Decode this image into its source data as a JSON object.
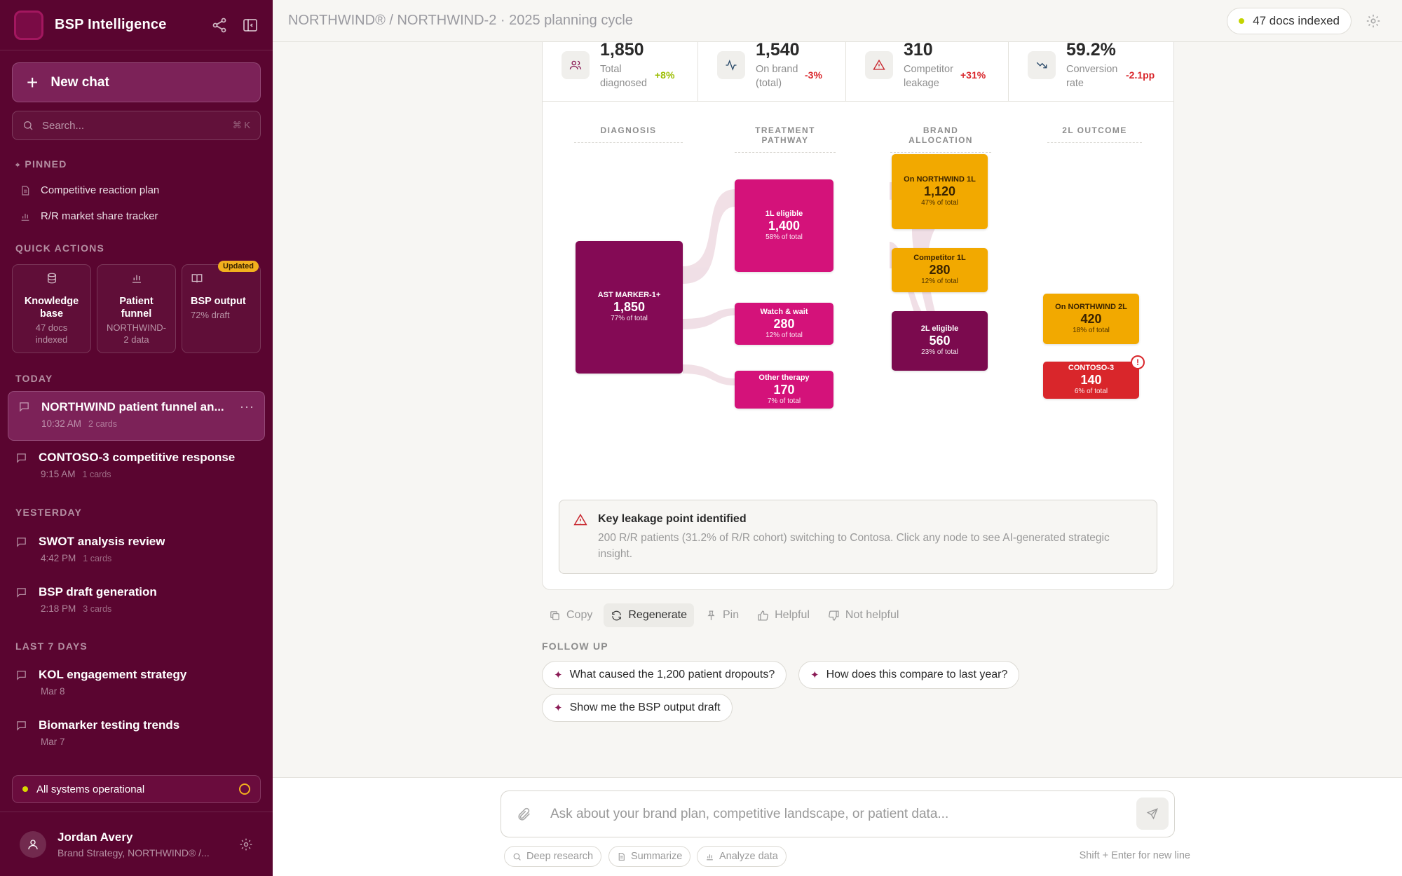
{
  "sidebar": {
    "brand": "BSP Intelligence",
    "new_chat": "New chat",
    "search_placeholder": "Search...",
    "search_shortcut": "⌘ K",
    "pinned_header": "PINNED",
    "pinned": [
      "Competitive reaction plan",
      "R/R market share tracker"
    ],
    "quick_actions_header": "QUICK ACTIONS",
    "quick_actions": [
      {
        "title": "Knowledge base",
        "sub": "47 docs indexed"
      },
      {
        "title": "Patient funnel",
        "sub": "NORTHWIND-2 data"
      },
      {
        "title": "BSP output",
        "sub": "72% draft",
        "badge": "Updated"
      }
    ],
    "groups": [
      {
        "label": "TODAY",
        "chats": [
          {
            "title": "NORTHWIND patient funnel an...",
            "time": "10:32 AM",
            "cards": "2 cards",
            "active": true
          },
          {
            "title": "CONTOSO-3 competitive response",
            "time": "9:15 AM",
            "cards": "1 cards"
          }
        ]
      },
      {
        "label": "YESTERDAY",
        "chats": [
          {
            "title": "SWOT analysis review",
            "time": "4:42 PM",
            "cards": "1 cards"
          },
          {
            "title": "BSP draft generation",
            "time": "2:18 PM",
            "cards": "3 cards"
          }
        ]
      },
      {
        "label": "LAST 7 DAYS",
        "chats": [
          {
            "title": "KOL engagement strategy",
            "time": "Mar 8",
            "cards": ""
          },
          {
            "title": "Biomarker testing trends",
            "time": "Mar 7",
            "cards": ""
          }
        ]
      }
    ],
    "status": "All systems operational",
    "user": {
      "name": "Jordan Avery",
      "role": "Brand Strategy, NORTHWIND® /..."
    }
  },
  "header": {
    "breadcrumb": "NORTHWIND® / NORTHWIND-2 · 2025 planning cycle",
    "docs_indexed": "47 docs indexed"
  },
  "kpis": [
    {
      "value": "1,850",
      "label1": "Total",
      "label2": "diagnosed",
      "change": "+8%",
      "change_color": "#9bbd00",
      "icon": "users-icon"
    },
    {
      "value": "1,540",
      "label1": "On brand",
      "label2": "(total)",
      "change": "-3%",
      "change_color": "#d9262b",
      "icon": "activity-icon"
    },
    {
      "value": "310",
      "label1": "Competitor",
      "label2": "leakage",
      "change": "+31%",
      "change_color": "#d9262b",
      "icon": "warning-icon"
    },
    {
      "value": "59.2%",
      "label1": "Conversion",
      "label2": "rate",
      "change": "-2.1pp",
      "change_color": "#d9262b",
      "icon": "trending-down-icon"
    }
  ],
  "funnel": {
    "columns": [
      "DIAGNOSIS",
      "TREATMENT PATHWAY",
      "BRAND ALLOCATION",
      "2L OUTCOME"
    ],
    "nodes": [
      {
        "id": "ast",
        "name": "AST MARKER-1+",
        "value": "1,850",
        "pct": "77% of total",
        "color": "#840a55"
      },
      {
        "id": "l1",
        "name": "1L eligible",
        "value": "1,400",
        "pct": "58% of total",
        "color": "#d4127a"
      },
      {
        "id": "ww",
        "name": "Watch & wait",
        "value": "280",
        "pct": "12% of total",
        "color": "#d4127a"
      },
      {
        "id": "ot",
        "name": "Other therapy",
        "value": "170",
        "pct": "7% of total",
        "color": "#d4127a"
      },
      {
        "id": "nw1",
        "name": "On NORTHWIND 1L",
        "value": "1,120",
        "pct": "47% of total",
        "color": "#f2a900"
      },
      {
        "id": "c1",
        "name": "Competitor 1L",
        "value": "280",
        "pct": "12% of total",
        "color": "#f2a900"
      },
      {
        "id": "l2",
        "name": "2L eligible",
        "value": "560",
        "pct": "23% of total",
        "color": "#7b0a4e"
      },
      {
        "id": "nw2",
        "name": "On NORTHWIND 2L",
        "value": "420",
        "pct": "18% of total",
        "color": "#f2a900"
      },
      {
        "id": "c3",
        "name": "CONTOSO-3",
        "value": "140",
        "pct": "6% of total",
        "color": "#d9262b"
      }
    ],
    "alert": "!"
  },
  "leakage": {
    "title": "Key leakage point identified",
    "body": "200 R/R patients (31.2% of R/R cohort) switching to Contosa. Click any node to see AI-generated strategic insight."
  },
  "actions": [
    "Copy",
    "Regenerate",
    "Pin",
    "Helpful",
    "Not helpful"
  ],
  "follow_up": {
    "label": "FOLLOW UP",
    "chips": [
      "What caused the 1,200 patient dropouts?",
      "How does this compare to last year?",
      "Show me the BSP output draft"
    ]
  },
  "composer": {
    "placeholder": "Ask about your brand plan, competitive landscape, or patient data...",
    "tools": [
      "Deep research",
      "Summarize",
      "Analyze data"
    ],
    "hint": "Shift + Enter for new line"
  }
}
